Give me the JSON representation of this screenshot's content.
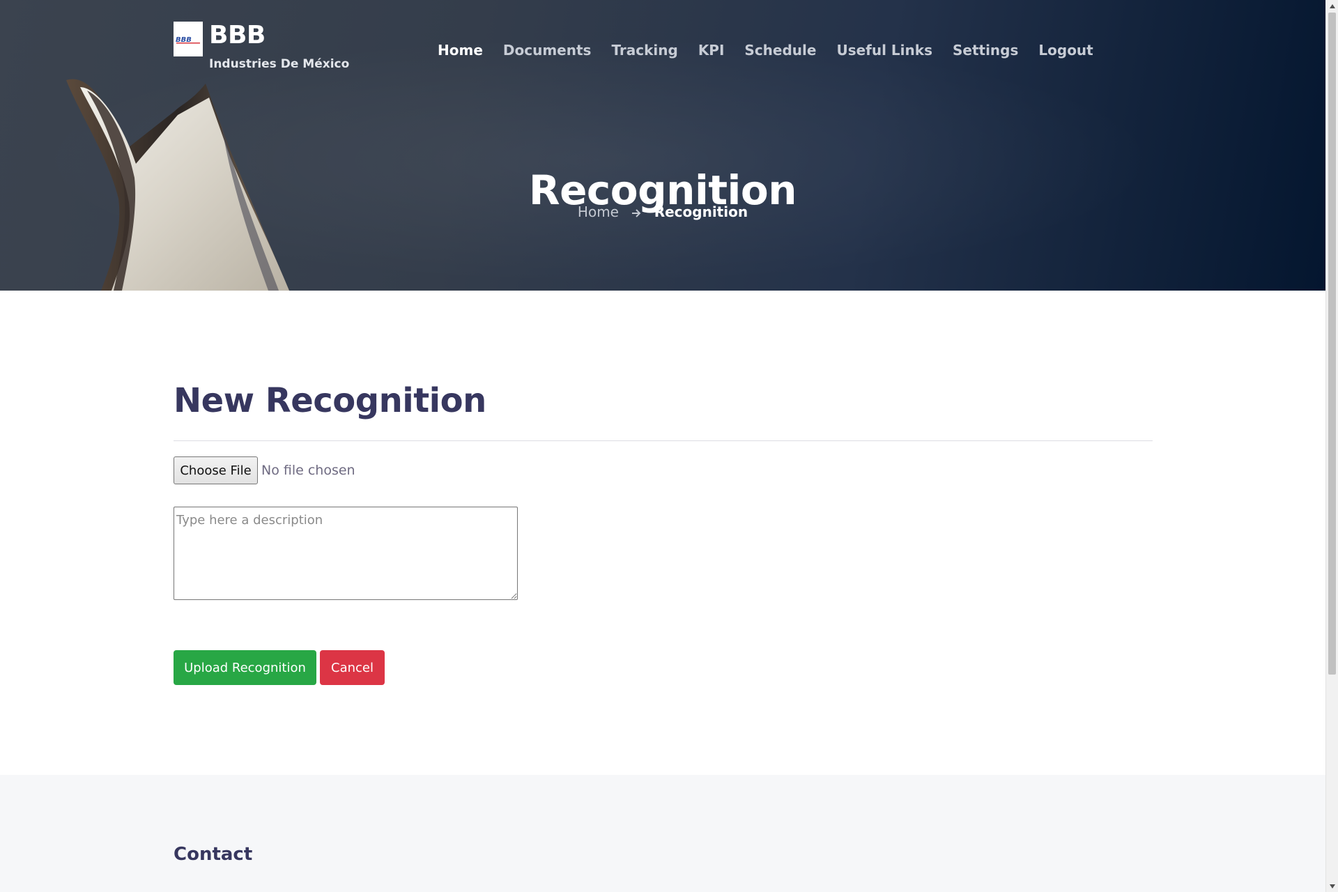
{
  "brand": {
    "name": "BBB",
    "subtitle": "Industries De México",
    "logo_text": "BBB"
  },
  "nav": {
    "items": [
      {
        "label": "Home",
        "active": true
      },
      {
        "label": "Documents",
        "active": false
      },
      {
        "label": "Tracking",
        "active": false
      },
      {
        "label": "KPI",
        "active": false
      },
      {
        "label": "Schedule",
        "active": false
      },
      {
        "label": "Useful Links",
        "active": false
      },
      {
        "label": "Settings",
        "active": false
      },
      {
        "label": "Logout",
        "active": false
      }
    ]
  },
  "hero": {
    "title": "Recognition",
    "breadcrumb": {
      "home": "Home",
      "current": "Recognition"
    },
    "image_icon": "trophy-star-icon"
  },
  "form": {
    "heading": "New Recognition",
    "file_button_label": "Choose File",
    "file_status": "No file chosen",
    "description_placeholder": "Type here a description",
    "description_value": "",
    "upload_label": "Upload Recognition",
    "cancel_label": "Cancel"
  },
  "footer": {
    "title": "Contact"
  },
  "colors": {
    "heading": "#37375f",
    "upload_button": "#28a745",
    "cancel_button": "#dc3545",
    "hero_dark": "#04162f",
    "footer_bg": "#f6f7f9"
  }
}
